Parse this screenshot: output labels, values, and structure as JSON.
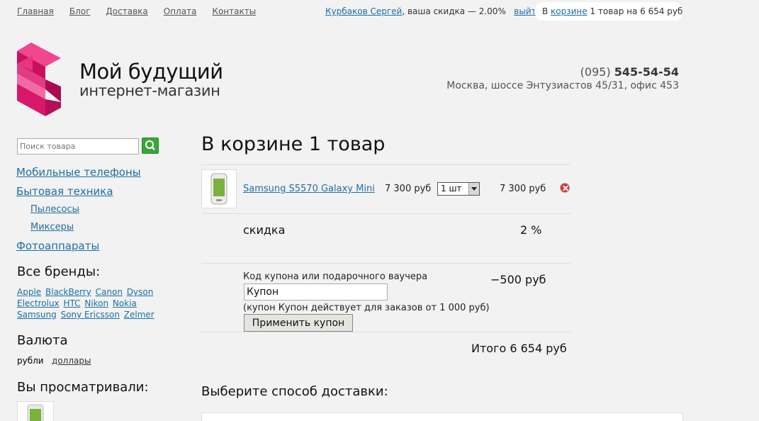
{
  "topnav": {
    "items": [
      {
        "label": "Главная"
      },
      {
        "label": "Блог"
      },
      {
        "label": "Доставка"
      },
      {
        "label": "Оплата"
      },
      {
        "label": "Контакты"
      }
    ]
  },
  "user": {
    "name": "Курбаков Сергей",
    "discount_text": ", ваша скидка — 2.00%",
    "logout_label": "выйти"
  },
  "cart_pill": {
    "prefix": "В ",
    "link": "корзине",
    "suffix": " 1 товар на 6 654 руб"
  },
  "logo": {
    "title": "Мой будущий",
    "subtitle": "интернет-магазин"
  },
  "contacts": {
    "phone_code": "(095)",
    "phone_number": "545-54-54",
    "address": "Москва, шоссе Энтузиастов 45/31, офис 453"
  },
  "search": {
    "placeholder": "Поиск товара"
  },
  "categories": [
    {
      "label": "Мобильные телефоны"
    },
    {
      "label": "Бытовая техника"
    },
    {
      "label": "Пылесосы"
    },
    {
      "label": "Миксеры"
    },
    {
      "label": "Фотоаппараты"
    }
  ],
  "brands": {
    "heading": "Все бренды:",
    "items": [
      "Apple",
      "BlackBerry",
      "Canon",
      "Dyson",
      "Electrolux",
      "HTC",
      "Nikon",
      "Nokia",
      "Samsung",
      "Sony Ericsson",
      "Zelmer"
    ]
  },
  "currency": {
    "heading": "Валюта",
    "current": "рубли",
    "other": "доллары"
  },
  "viewed": {
    "heading": "Вы просматривали:"
  },
  "cart": {
    "title": "В корзине 1 товар",
    "item": {
      "name": "Samsung S5570 Galaxy Mini",
      "price": "7 300 руб",
      "qty": "1 шт",
      "total": "7 300 руб"
    },
    "discount_label": "скидка",
    "discount_value": "2 %",
    "coupon_label": "Код купона или подарочного ваучера",
    "coupon_value": "Купон",
    "coupon_note": "(купон Купон действует для заказов от 1 000 руб)",
    "coupon_button": "Применить купон",
    "coupon_amount": "−500 руб",
    "total": "Итого 6 654 руб"
  },
  "delivery": {
    "heading": "Выберите способ доставки:"
  },
  "colors": {
    "link": "#1d6fa3",
    "background": "#f2f2f2",
    "search_button": "#3aa63a",
    "remove_icon": "#dd3333",
    "logo_pink": "#d8176b"
  },
  "icons": {
    "search": "magnifier-icon",
    "remove": "remove-x-icon",
    "logo": "s-logo-icon"
  }
}
